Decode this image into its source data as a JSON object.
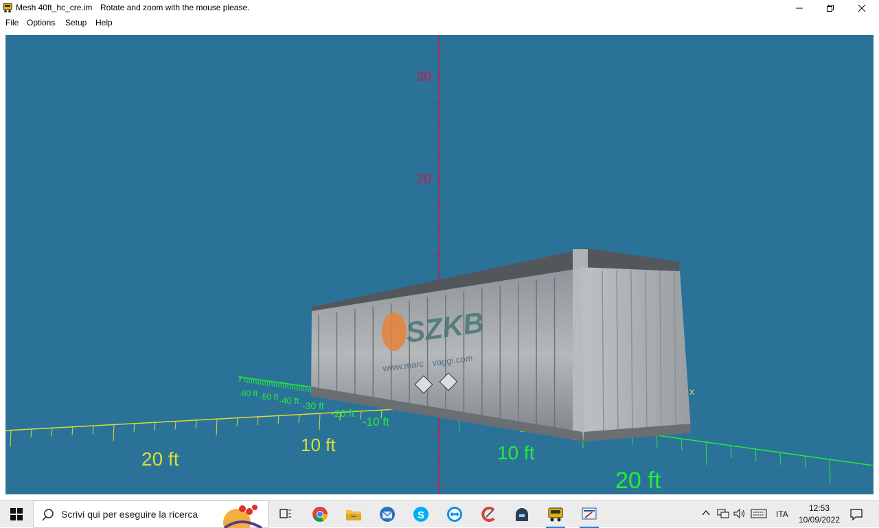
{
  "window": {
    "title": "Mesh 40ft_hc_cre.im",
    "subtitle": "Rotate and zoom with the mouse please.",
    "menu": [
      {
        "label": "File"
      },
      {
        "label": "Options"
      },
      {
        "label": "Setup"
      },
      {
        "label": "Help"
      }
    ]
  },
  "scene": {
    "background_color": "#2b7299",
    "vertical_axis_color": "#c01c4a",
    "horizontal_axis_color": "#dddd33",
    "depth_axis_color": "#22ee33",
    "vertical_axis_labels": [
      "30",
      "20"
    ],
    "horizontal_axis_labels": [
      "20 ft",
      "10 ft",
      "10 ft",
      "20 ft"
    ],
    "depth_axis_labels": [
      "-60 ft",
      "-50 ft",
      "-40 ft",
      "-30 ft",
      "-20 ft",
      "-10 ft",
      "10"
    ],
    "axis_end_labels": [
      "y",
      "x"
    ],
    "container_print": [
      "www.marc",
      "vaggi.com"
    ]
  },
  "taskbar": {
    "search_placeholder": "Scrivi qui per eseguire la ricerca",
    "language": "ITA",
    "time": "12:53",
    "date": "10/09/2022",
    "icons": [
      "windows-start-icon",
      "task-view-icon",
      "chrome-icon",
      "file-explorer-icon",
      "thunderbird-icon",
      "skype-icon",
      "teamviewer-icon",
      "ccleaner-icon",
      "vpn-icon",
      "truck-app-icon",
      "settings-app-icon"
    ]
  }
}
